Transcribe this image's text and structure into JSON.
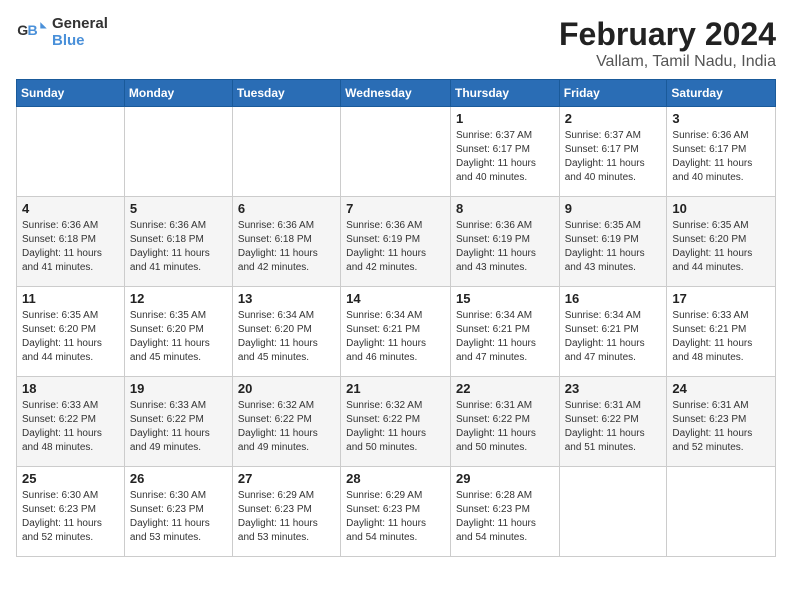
{
  "logo": {
    "line1": "General",
    "line2": "Blue"
  },
  "title": "February 2024",
  "location": "Vallam, Tamil Nadu, India",
  "days_of_week": [
    "Sunday",
    "Monday",
    "Tuesday",
    "Wednesday",
    "Thursday",
    "Friday",
    "Saturday"
  ],
  "weeks": [
    [
      {
        "num": "",
        "info": ""
      },
      {
        "num": "",
        "info": ""
      },
      {
        "num": "",
        "info": ""
      },
      {
        "num": "",
        "info": ""
      },
      {
        "num": "1",
        "info": "Sunrise: 6:37 AM\nSunset: 6:17 PM\nDaylight: 11 hours\nand 40 minutes."
      },
      {
        "num": "2",
        "info": "Sunrise: 6:37 AM\nSunset: 6:17 PM\nDaylight: 11 hours\nand 40 minutes."
      },
      {
        "num": "3",
        "info": "Sunrise: 6:36 AM\nSunset: 6:17 PM\nDaylight: 11 hours\nand 40 minutes."
      }
    ],
    [
      {
        "num": "4",
        "info": "Sunrise: 6:36 AM\nSunset: 6:18 PM\nDaylight: 11 hours\nand 41 minutes."
      },
      {
        "num": "5",
        "info": "Sunrise: 6:36 AM\nSunset: 6:18 PM\nDaylight: 11 hours\nand 41 minutes."
      },
      {
        "num": "6",
        "info": "Sunrise: 6:36 AM\nSunset: 6:18 PM\nDaylight: 11 hours\nand 42 minutes."
      },
      {
        "num": "7",
        "info": "Sunrise: 6:36 AM\nSunset: 6:19 PM\nDaylight: 11 hours\nand 42 minutes."
      },
      {
        "num": "8",
        "info": "Sunrise: 6:36 AM\nSunset: 6:19 PM\nDaylight: 11 hours\nand 43 minutes."
      },
      {
        "num": "9",
        "info": "Sunrise: 6:35 AM\nSunset: 6:19 PM\nDaylight: 11 hours\nand 43 minutes."
      },
      {
        "num": "10",
        "info": "Sunrise: 6:35 AM\nSunset: 6:20 PM\nDaylight: 11 hours\nand 44 minutes."
      }
    ],
    [
      {
        "num": "11",
        "info": "Sunrise: 6:35 AM\nSunset: 6:20 PM\nDaylight: 11 hours\nand 44 minutes."
      },
      {
        "num": "12",
        "info": "Sunrise: 6:35 AM\nSunset: 6:20 PM\nDaylight: 11 hours\nand 45 minutes."
      },
      {
        "num": "13",
        "info": "Sunrise: 6:34 AM\nSunset: 6:20 PM\nDaylight: 11 hours\nand 45 minutes."
      },
      {
        "num": "14",
        "info": "Sunrise: 6:34 AM\nSunset: 6:21 PM\nDaylight: 11 hours\nand 46 minutes."
      },
      {
        "num": "15",
        "info": "Sunrise: 6:34 AM\nSunset: 6:21 PM\nDaylight: 11 hours\nand 47 minutes."
      },
      {
        "num": "16",
        "info": "Sunrise: 6:34 AM\nSunset: 6:21 PM\nDaylight: 11 hours\nand 47 minutes."
      },
      {
        "num": "17",
        "info": "Sunrise: 6:33 AM\nSunset: 6:21 PM\nDaylight: 11 hours\nand 48 minutes."
      }
    ],
    [
      {
        "num": "18",
        "info": "Sunrise: 6:33 AM\nSunset: 6:22 PM\nDaylight: 11 hours\nand 48 minutes."
      },
      {
        "num": "19",
        "info": "Sunrise: 6:33 AM\nSunset: 6:22 PM\nDaylight: 11 hours\nand 49 minutes."
      },
      {
        "num": "20",
        "info": "Sunrise: 6:32 AM\nSunset: 6:22 PM\nDaylight: 11 hours\nand 49 minutes."
      },
      {
        "num": "21",
        "info": "Sunrise: 6:32 AM\nSunset: 6:22 PM\nDaylight: 11 hours\nand 50 minutes."
      },
      {
        "num": "22",
        "info": "Sunrise: 6:31 AM\nSunset: 6:22 PM\nDaylight: 11 hours\nand 50 minutes."
      },
      {
        "num": "23",
        "info": "Sunrise: 6:31 AM\nSunset: 6:22 PM\nDaylight: 11 hours\nand 51 minutes."
      },
      {
        "num": "24",
        "info": "Sunrise: 6:31 AM\nSunset: 6:23 PM\nDaylight: 11 hours\nand 52 minutes."
      }
    ],
    [
      {
        "num": "25",
        "info": "Sunrise: 6:30 AM\nSunset: 6:23 PM\nDaylight: 11 hours\nand 52 minutes."
      },
      {
        "num": "26",
        "info": "Sunrise: 6:30 AM\nSunset: 6:23 PM\nDaylight: 11 hours\nand 53 minutes."
      },
      {
        "num": "27",
        "info": "Sunrise: 6:29 AM\nSunset: 6:23 PM\nDaylight: 11 hours\nand 53 minutes."
      },
      {
        "num": "28",
        "info": "Sunrise: 6:29 AM\nSunset: 6:23 PM\nDaylight: 11 hours\nand 54 minutes."
      },
      {
        "num": "29",
        "info": "Sunrise: 6:28 AM\nSunset: 6:23 PM\nDaylight: 11 hours\nand 54 minutes."
      },
      {
        "num": "",
        "info": ""
      },
      {
        "num": "",
        "info": ""
      }
    ]
  ]
}
